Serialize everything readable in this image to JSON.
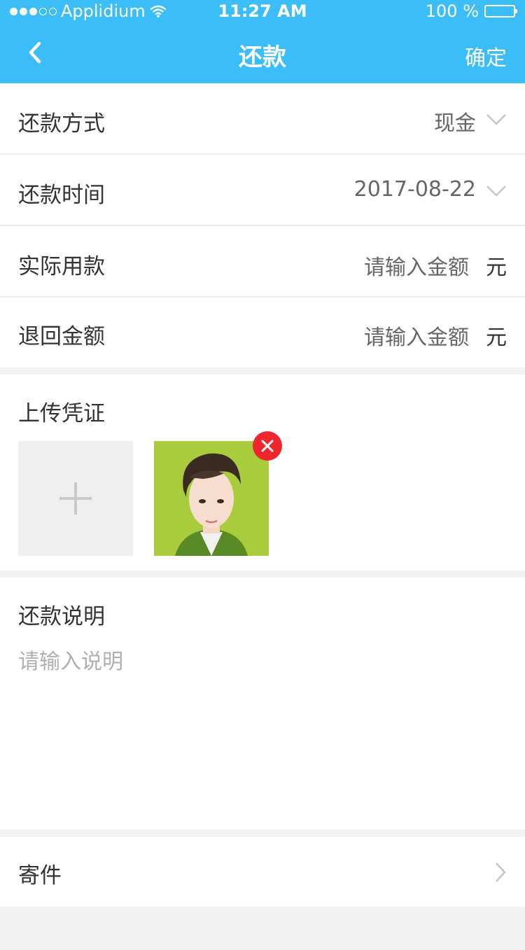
{
  "status_bar": {
    "carrier": "Applidium",
    "time": "11:27 AM",
    "battery": "100 %"
  },
  "nav": {
    "title": "还款",
    "confirm": "确定"
  },
  "form": {
    "method_label": "还款方式",
    "method_value": "现金",
    "date_label": "还款时间",
    "date_value": "2017-08-22",
    "actual_label": "实际用款",
    "actual_placeholder": "请输入金额",
    "actual_unit": "元",
    "refund_label": "退回金额",
    "refund_placeholder": "请输入金额",
    "refund_unit": "元"
  },
  "upload": {
    "label": "上传凭证"
  },
  "description": {
    "label": "还款说明",
    "placeholder": "请输入说明"
  },
  "mail": {
    "label": "寄件"
  },
  "colors": {
    "primary": "#3bbef7",
    "delete": "#f0262e"
  }
}
